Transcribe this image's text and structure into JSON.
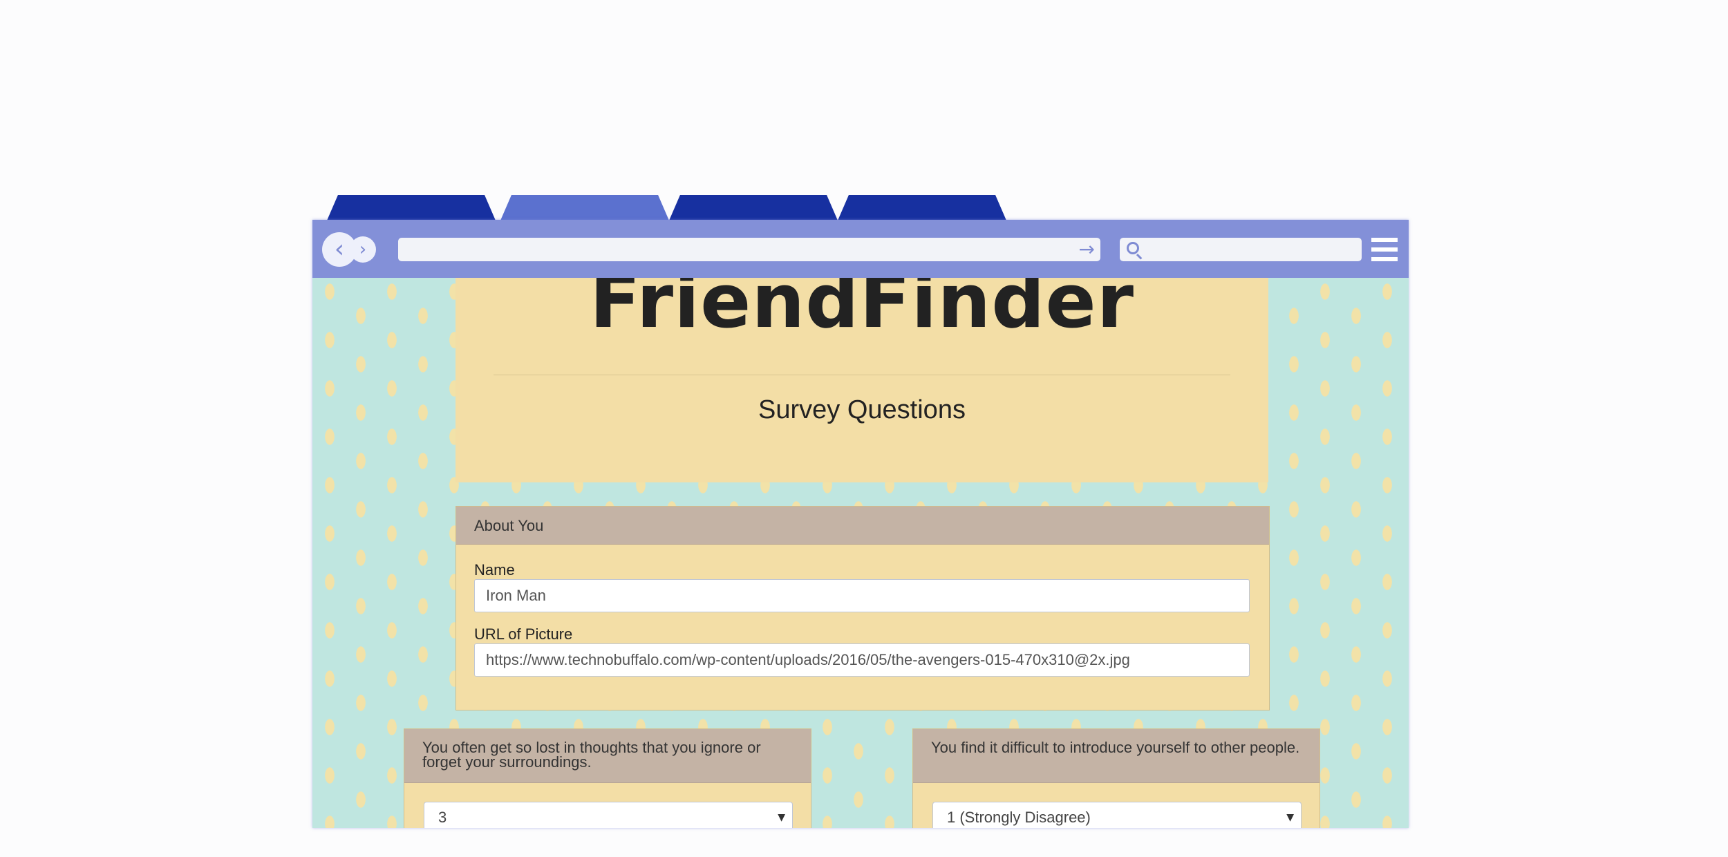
{
  "tabs": [
    "",
    "",
    "",
    ""
  ],
  "browser": {
    "address_value": "",
    "search_value": ""
  },
  "header": {
    "brand": "FriendFinder",
    "subtitle": "Survey Questions"
  },
  "about": {
    "title": "About You",
    "name_label": "Name",
    "name_value": "Iron Man",
    "photo_label": "URL of Picture",
    "photo_value": "https://www.technobuffalo.com/wp-content/uploads/2016/05/the-avengers-015-470x310@2x.jpg"
  },
  "questions": [
    {
      "text": "You often get so lost in thoughts that you ignore or forget your surroundings.",
      "selected": "3"
    },
    {
      "text": "You find it difficult to introduce yourself to other people.",
      "selected": "1 (Strongly Disagree)"
    }
  ],
  "icons": {
    "back": "chevron-left-icon",
    "forward": "chevron-right-icon",
    "go": "arrow-right-icon",
    "search": "search-icon",
    "menu": "hamburger-menu-icon"
  },
  "colors": {
    "tab": "#1730a0",
    "tab_active": "#5b71cf",
    "toolbar": "#8390d8",
    "panel": "#f3dea6",
    "panel_header": "#c4b3a5",
    "page_bg": "#bfe6e0"
  }
}
